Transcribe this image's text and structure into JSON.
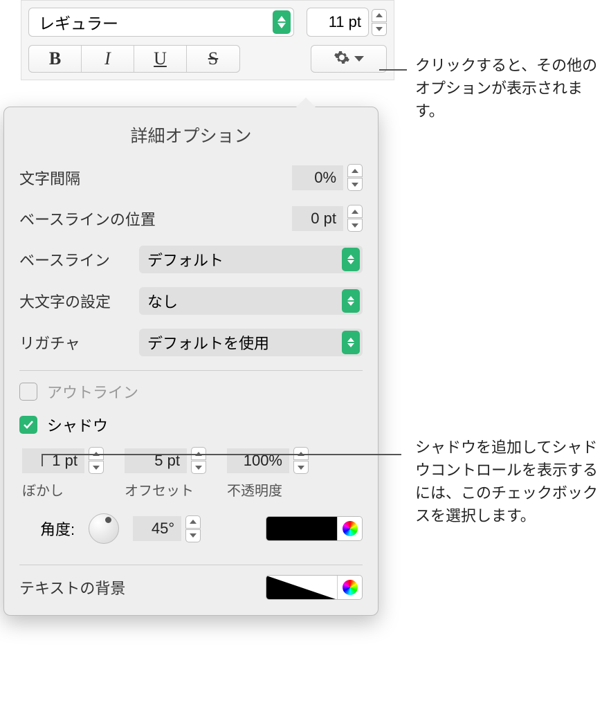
{
  "top": {
    "font_style": "レギュラー",
    "font_size": "11 pt"
  },
  "style_buttons": {
    "bold": "B",
    "italic": "I",
    "underline": "U",
    "strike": "S"
  },
  "popover": {
    "title": "詳細オプション",
    "char_spacing_label": "文字間隔",
    "char_spacing_value": "0%",
    "baseline_pos_label": "ベースラインの位置",
    "baseline_pos_value": "0 pt",
    "baseline_label": "ベースライン",
    "baseline_value": "デフォルト",
    "caps_label": "大文字の設定",
    "caps_value": "なし",
    "ligature_label": "リガチャ",
    "ligature_value": "デフォルトを使用",
    "outline_label": "アウトライン",
    "shadow_label": "シャドウ",
    "shadow": {
      "blur_value": "1 pt",
      "blur_label": "ぼかし",
      "offset_value": "5 pt",
      "offset_label": "オフセット",
      "opacity_value": "100%",
      "opacity_label": "不透明度",
      "angle_label": "角度:",
      "angle_value": "45°"
    },
    "text_bg_label": "テキストの背景"
  },
  "callouts": {
    "gear": "クリックすると、その他のオプションが表示されます。",
    "shadow": "シャドウを追加してシャドウコントロールを表示するには、このチェックボックスを選択します。"
  }
}
